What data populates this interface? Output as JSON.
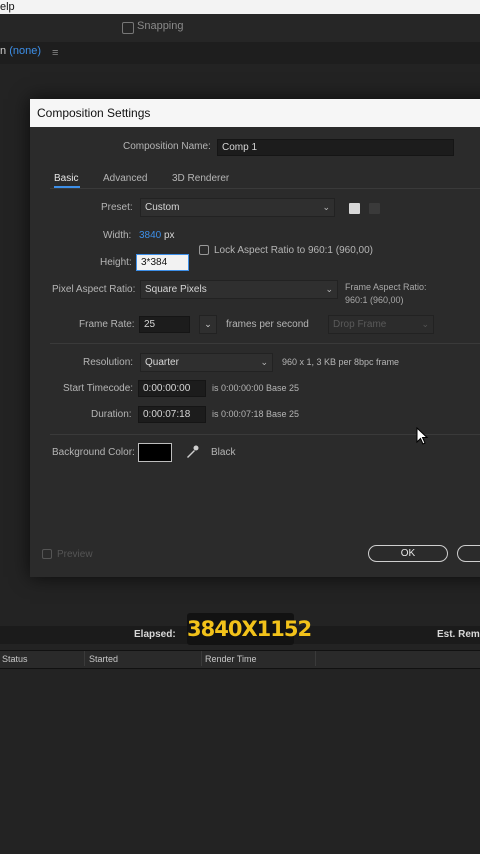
{
  "menu": {
    "help_fragment": "elp"
  },
  "toolbar": {
    "snapping_label": "Snapping"
  },
  "panel": {
    "layer_prefix": "n",
    "layer_value": "(none)"
  },
  "dialog": {
    "title": "Composition Settings",
    "comp_name_label": "Composition Name:",
    "comp_name_value": "Comp 1",
    "tabs": [
      "Basic",
      "Advanced",
      "3D Renderer"
    ],
    "preset_label": "Preset:",
    "preset_value": "Custom",
    "width_label": "Width:",
    "width_value": "3840",
    "width_unit": "px",
    "lock_aspect_label": "Lock Aspect Ratio to 960:1 (960,00)",
    "height_label": "Height:",
    "height_value": "3*384",
    "par_label": "Pixel Aspect Ratio:",
    "par_value": "Square Pixels",
    "frame_aspect_label": "Frame Aspect Ratio:",
    "frame_aspect_value": "960:1 (960,00)",
    "frame_rate_label": "Frame Rate:",
    "frame_rate_value": "25",
    "frame_rate_unit": "frames per second",
    "drop_frame_value": "Drop Frame",
    "resolution_label": "Resolution:",
    "resolution_value": "Quarter",
    "resolution_info": "960 x 1, 3 KB per 8bpc frame",
    "start_tc_label": "Start Timecode:",
    "start_tc_value": "0:00:00:00",
    "start_tc_info": "is 0:00:00:00  Base 25",
    "duration_label": "Duration:",
    "duration_value": "0:00:07:18",
    "duration_info": "is 0:00:07:18  Base 25",
    "bg_color_label": "Background Color:",
    "bg_color_name": "Black",
    "bg_color_hex": "#000000",
    "preview_label": "Preview",
    "ok_label": "OK"
  },
  "render_queue": {
    "elapsed_label": "Elapsed:",
    "caption": "3840X1152",
    "est_remain_label": "Est. Rema",
    "columns": [
      "Status",
      "Started",
      "Render Time"
    ]
  },
  "colors": {
    "accent": "#3d8fe8",
    "caption": "#f2c21a"
  }
}
